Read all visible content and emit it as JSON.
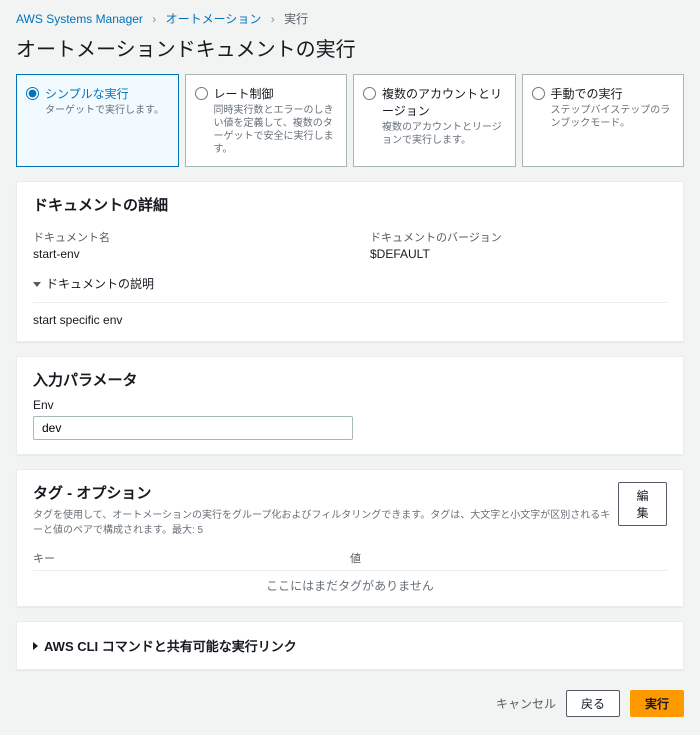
{
  "breadcrumb": {
    "service": "AWS Systems Manager",
    "section": "オートメーション",
    "current": "実行"
  },
  "pageTitle": "オートメーションドキュメントの実行",
  "options": [
    {
      "title": "シンプルな実行",
      "desc": "ターゲットで実行します。"
    },
    {
      "title": "レート制御",
      "desc": "同時実行数とエラーのしきい値を定義して、複数のターゲットで安全に実行します。"
    },
    {
      "title": "複数のアカウントとリージョン",
      "desc": "複数のアカウントとリージョンで実行します。"
    },
    {
      "title": "手動での実行",
      "desc": "ステップバイステップのランブックモード。"
    }
  ],
  "docPanel": {
    "header": "ドキュメントの詳細",
    "nameLabel": "ドキュメント名",
    "nameValue": "start-env",
    "versionLabel": "ドキュメントのバージョン",
    "versionValue": "$DEFAULT",
    "expander": "ドキュメントの説明",
    "description": "start specific env"
  },
  "inputPanel": {
    "header": "入力パラメータ",
    "fieldLabel": "Env",
    "fieldValue": "dev"
  },
  "tagsPanel": {
    "title": "タグ - オプション",
    "sub": "タグを使用して、オートメーションの実行をグループ化およびフィルタリングできます。タグは、大文字と小文字が区別されるキーと値のペアで構成されます。最大: 5",
    "editBtn": "編集",
    "keyCol": "キー",
    "valCol": "値",
    "empty": "ここにはまだタグがありません"
  },
  "cliPanel": {
    "title": "AWS CLI コマンドと共有可能な実行リンク"
  },
  "footer": {
    "cancel": "キャンセル",
    "back": "戻る",
    "execute": "実行"
  }
}
